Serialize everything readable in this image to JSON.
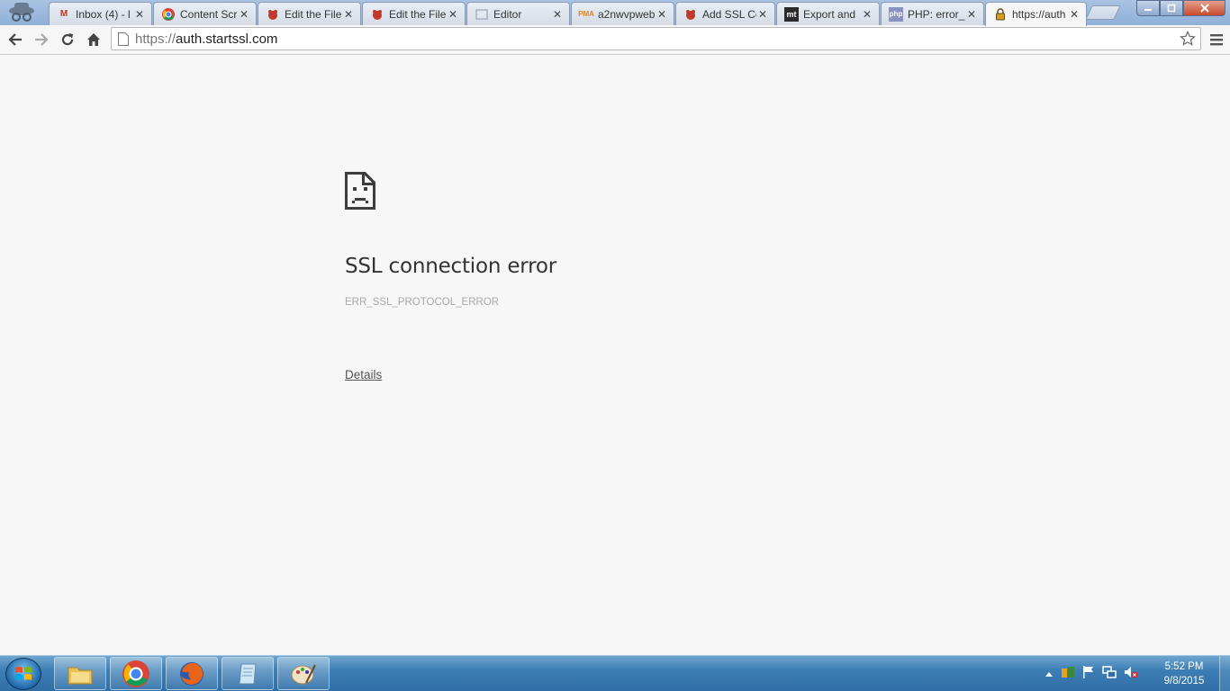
{
  "browser": {
    "tabs": [
      {
        "title": "Inbox (4) - l",
        "icon": "gmail-icon"
      },
      {
        "title": "Content Scr",
        "icon": "chrome-icon"
      },
      {
        "title": "Edit the File",
        "icon": "bug-icon"
      },
      {
        "title": "Edit the File",
        "icon": "bug-icon"
      },
      {
        "title": "Editor",
        "icon": "editor-icon"
      },
      {
        "title": "a2nwvpweb",
        "icon": "phpmyadmin-icon"
      },
      {
        "title": "Add SSL Ce",
        "icon": "bug-icon"
      },
      {
        "title": "Export and",
        "icon": "mt-icon"
      },
      {
        "title": "PHP: error_",
        "icon": "php-icon"
      },
      {
        "title": "https://auth",
        "icon": "lock-icon",
        "active": true
      }
    ],
    "close_glyph": "✕",
    "omnibox": {
      "scheme": "https://",
      "host": "auth.startssl.com"
    }
  },
  "page": {
    "title": "SSL connection error",
    "error_code": "ERR_SSL_PROTOCOL_ERROR",
    "details_link": "Details"
  },
  "taskbar": {
    "apps": [
      "file-explorer-icon",
      "chrome-icon",
      "firefox-icon",
      "notepad-icon",
      "paint-icon"
    ],
    "clock_time": "5:52 PM",
    "clock_date": "9/8/2015"
  },
  "colors": {
    "accent": "#2f6ea6",
    "page_bg": "#f7f7f7",
    "title": "#333333",
    "code": "#a8a8a8"
  }
}
